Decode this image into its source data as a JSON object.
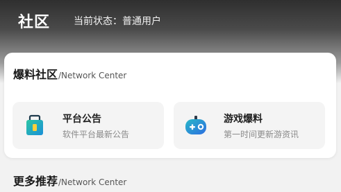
{
  "header": {
    "title": "社区",
    "status": "当前状态：普通用户"
  },
  "card": {
    "title": "爆料社区",
    "subtitle": "/Network Center",
    "tiles": [
      {
        "icon": "briefcase-icon",
        "title": "平台公告",
        "subtitle": "软件平台最新公告"
      },
      {
        "icon": "gamepad-icon",
        "title": "游戏爆料",
        "subtitle": "第一时间更新游资讯"
      }
    ]
  },
  "more": {
    "title": "更多推荐",
    "subtitle": "/Network Center"
  },
  "colors": {
    "header_dark": "#2f2f2f",
    "briefcase_accent": "#1fb3a8",
    "gamepad_accent": "#2e8ee0"
  }
}
